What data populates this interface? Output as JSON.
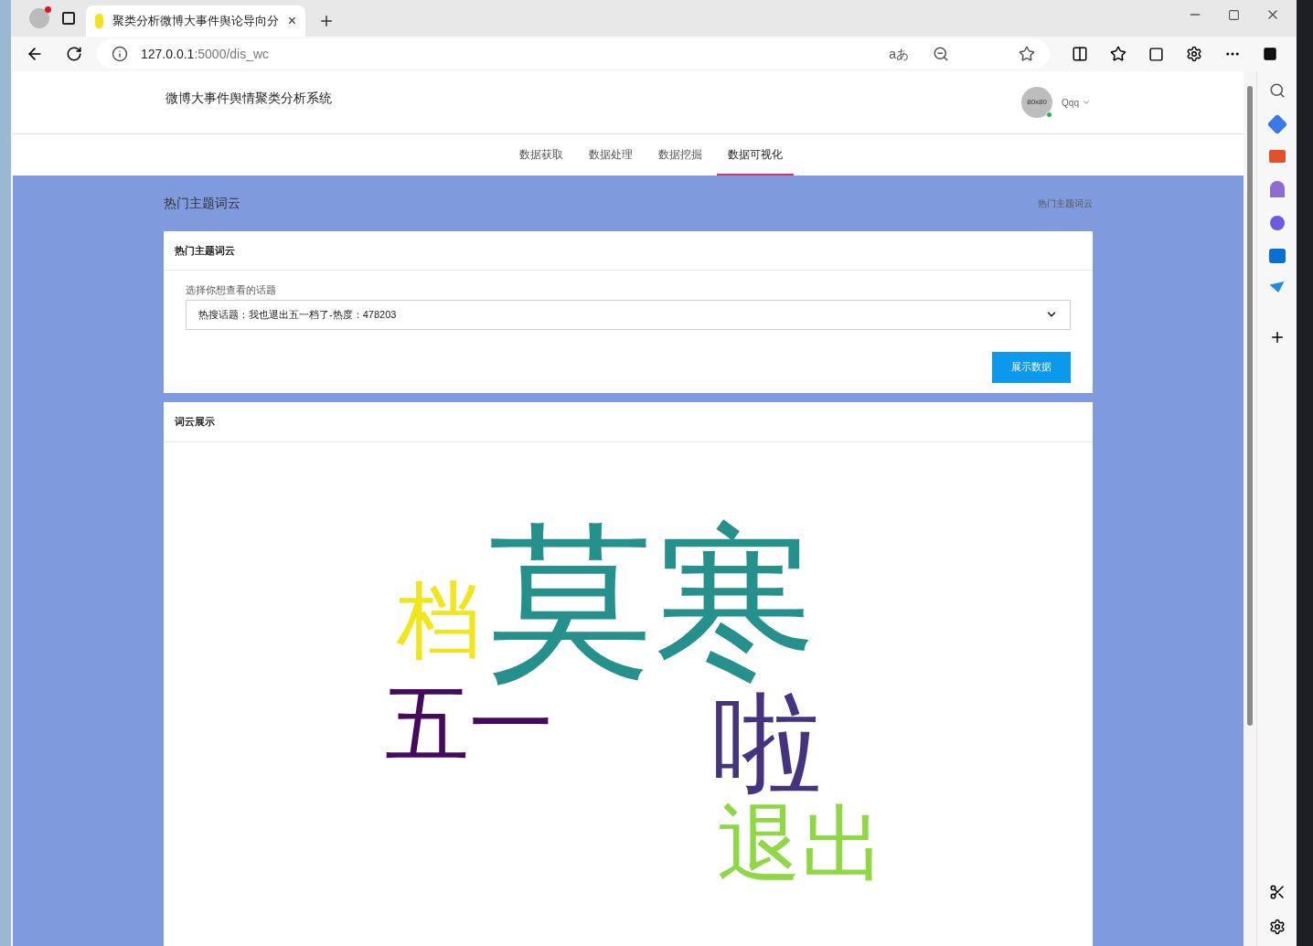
{
  "browser": {
    "tab_title": "聚类分析微博大事件舆论导向分",
    "tab_close": "×",
    "url_host": "127.0.0.1",
    "url_path": ":5000/dis_wc",
    "translate_label": "aあ"
  },
  "header": {
    "title": "微博大事件舆情聚类分析系统",
    "avatar_text": "80x80",
    "online": true,
    "user": "Qqq"
  },
  "nav": [
    {
      "label": "数据获取",
      "selected": false
    },
    {
      "label": "数据处理",
      "selected": false
    },
    {
      "label": "数据挖掘",
      "selected": false
    },
    {
      "label": "数据可视化",
      "selected": true
    }
  ],
  "page": {
    "heading": "热门主题词云",
    "breadcrumb": "热门主题词云"
  },
  "topic_card": {
    "title": "热门主题词云",
    "field_label": "选择你想查看的话题",
    "selected_topic": "热搜话题：我也退出五一档了-热度：478203",
    "button": "展示数据"
  },
  "cloud_card": {
    "title": "词云展示",
    "words": [
      {
        "text": "档",
        "color": "#f1e51d"
      },
      {
        "text": "莫寒",
        "color": "#26908d"
      },
      {
        "text": "五一",
        "color": "#450a5e"
      },
      {
        "text": "啦",
        "color": "#46337e"
      },
      {
        "text": "退出",
        "color": "#8fd744"
      }
    ]
  }
}
